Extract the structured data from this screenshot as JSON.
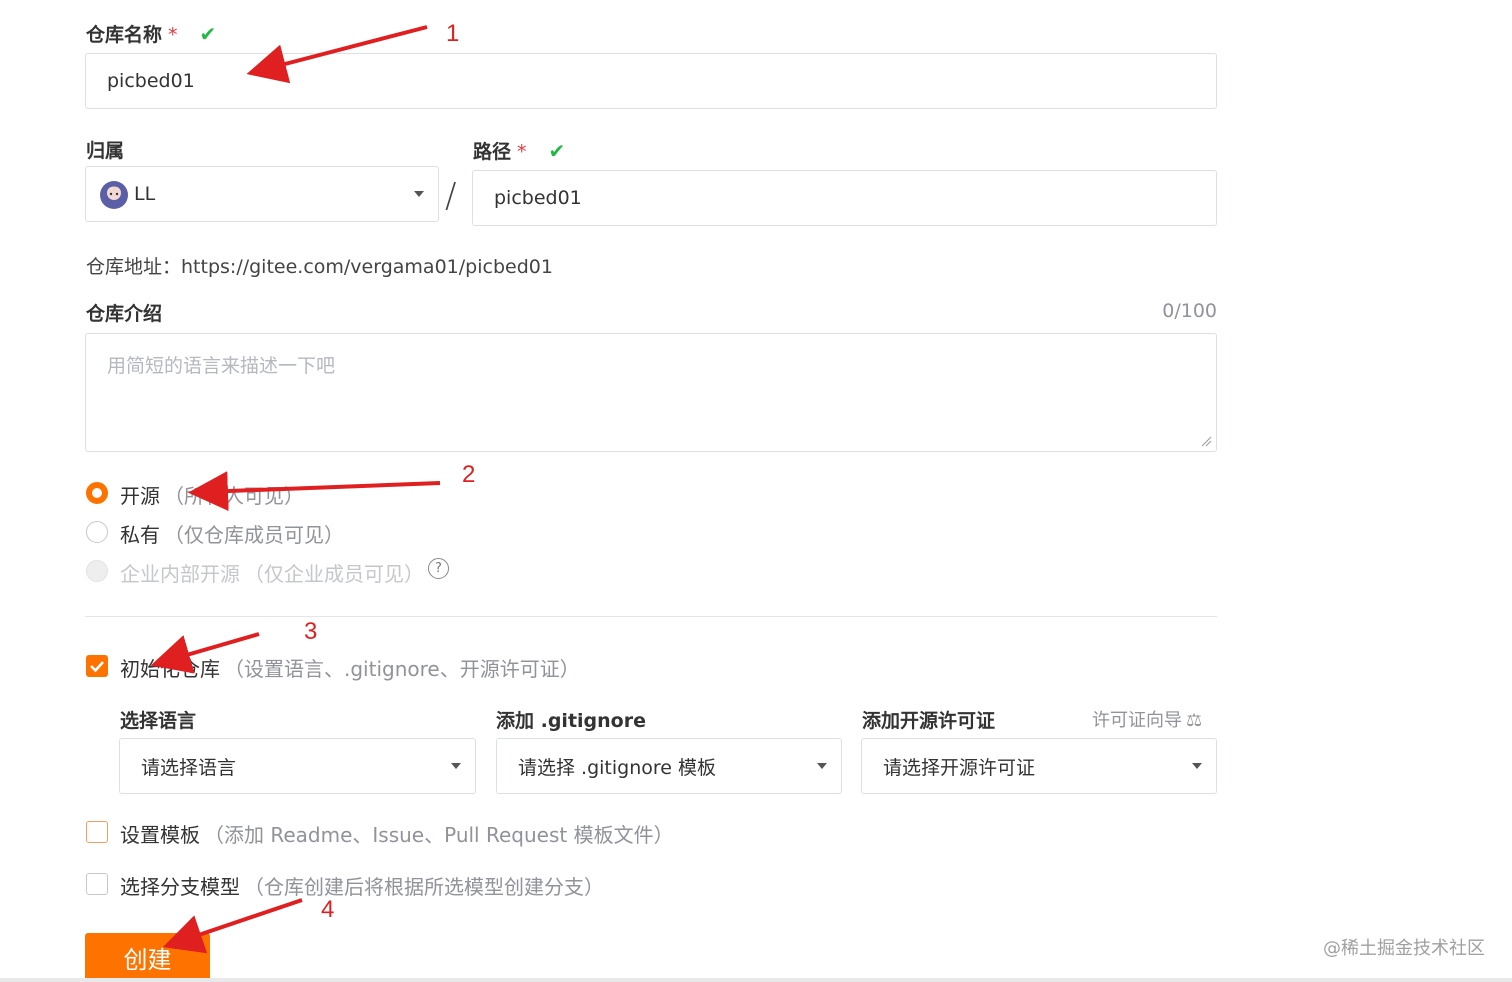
{
  "repo_name": {
    "label": "仓库名称",
    "required": "*",
    "value": "picbed01"
  },
  "owner": {
    "label": "归属",
    "value": "LL"
  },
  "path": {
    "label": "路径",
    "required": "*",
    "value": "picbed01"
  },
  "separator": "/",
  "repo_url": {
    "label": "仓库地址：",
    "value": "https://gitee.com/vergama01/picbed01"
  },
  "intro": {
    "label": "仓库介绍",
    "counter": "0/100",
    "placeholder": "用简短的语言来描述一下吧"
  },
  "visibility": {
    "selected": "open",
    "options": [
      {
        "label": "开源",
        "hint": "（所有人可见）"
      },
      {
        "label": "私有",
        "hint": "（仅仓库成员可见）"
      },
      {
        "label": "企业内部开源",
        "hint": "（仅企业成员可见）"
      }
    ]
  },
  "init_repo": {
    "checked": true,
    "label": "初始化仓库",
    "hint": "（设置语言、.gitignore、开源许可证）"
  },
  "language": {
    "label": "选择语言",
    "value": "请选择语言"
  },
  "gitignore": {
    "label": "添加 .gitignore",
    "value": "请选择 .gitignore 模板"
  },
  "license": {
    "label": "添加开源许可证",
    "guide": "许可证向导",
    "value": "请选择开源许可证"
  },
  "template": {
    "checked": false,
    "label": "设置模板",
    "hint": "（添加 Readme、Issue、Pull Request 模板文件）"
  },
  "branch_model": {
    "checked": false,
    "label": "选择分支模型",
    "hint": "（仓库创建后将根据所选模型创建分支）"
  },
  "submit": {
    "label": "创建"
  },
  "watermark": "@稀土掘金技术社区",
  "annotations": [
    "1",
    "2",
    "3",
    "4"
  ],
  "colors": {
    "accent": "#fe7300",
    "check": "#21ba45",
    "annotation": "#e02020"
  }
}
